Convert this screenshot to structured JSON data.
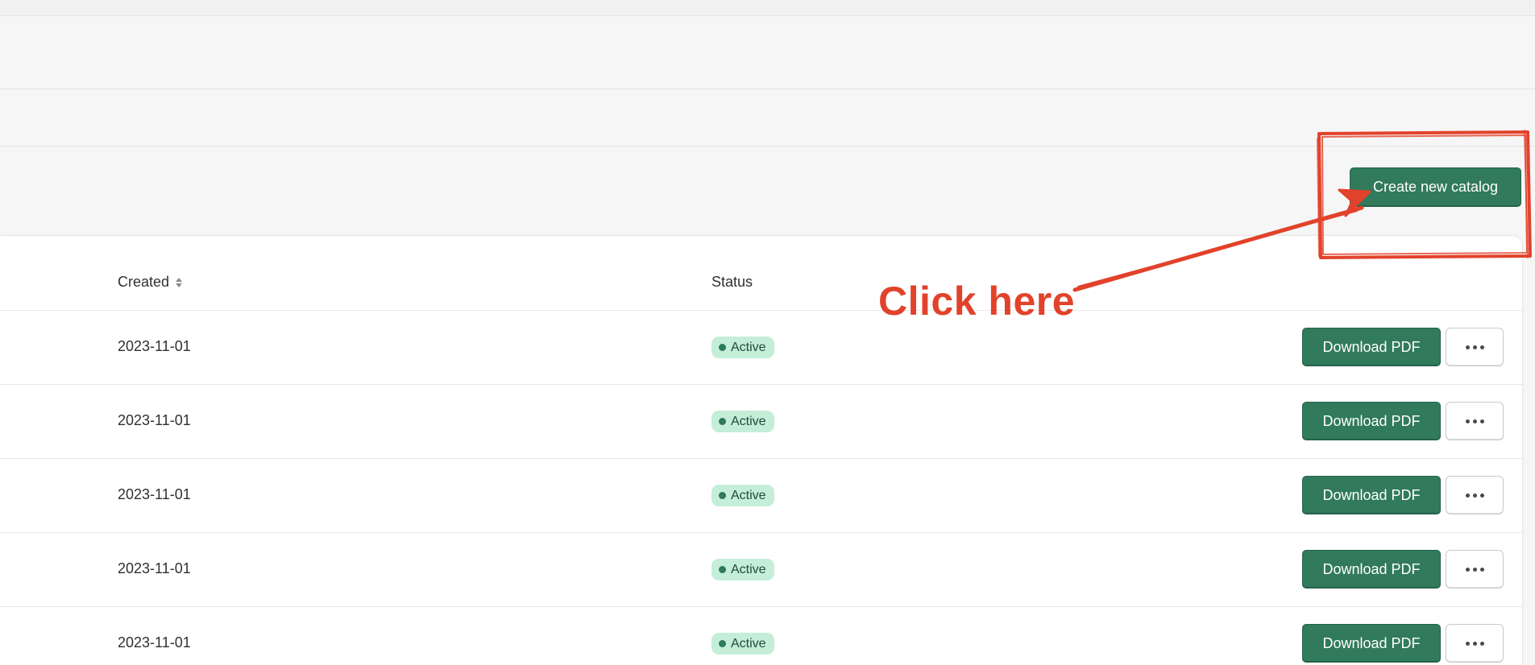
{
  "toolbar": {
    "create_label": "Create new catalog"
  },
  "table": {
    "columns": {
      "created": "Created",
      "status": "Status"
    },
    "download_label": "Download PDF",
    "rows": [
      {
        "created": "2023-11-01",
        "status": "Active"
      },
      {
        "created": "2023-11-01",
        "status": "Active"
      },
      {
        "created": "2023-11-01",
        "status": "Active"
      },
      {
        "created": "2023-11-01",
        "status": "Active"
      },
      {
        "created": "2023-11-01",
        "status": "Active"
      }
    ]
  },
  "annotation": {
    "text": "Click here",
    "color": "#e2422b"
  },
  "colors": {
    "primary": "#317a5c",
    "badge_bg": "#c4eed8",
    "badge_dot": "#2f7a57"
  }
}
